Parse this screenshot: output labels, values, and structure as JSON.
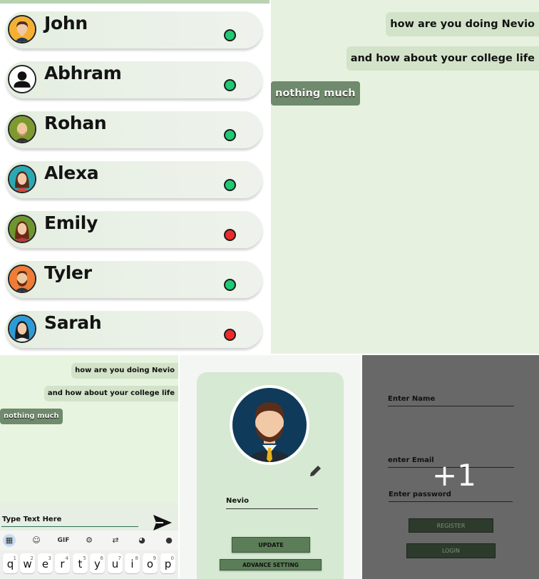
{
  "contacts": [
    {
      "name": "John",
      "status": "online",
      "status_color": "#1ecb74",
      "avatar": "man-orange-avatar-icon"
    },
    {
      "name": "Abhram",
      "status": "online",
      "status_color": "#1ecb74",
      "avatar": "default-person-icon"
    },
    {
      "name": "Rohan",
      "status": "online",
      "status_color": "#1ecb74",
      "avatar": "bald-man-avatar-icon"
    },
    {
      "name": "Alexa",
      "status": "online",
      "status_color": "#1ecb74",
      "avatar": "woman-teal-avatar-icon"
    },
    {
      "name": "Emily",
      "status": "offline",
      "status_color": "#ee2b2b",
      "avatar": "woman-green-avatar-icon"
    },
    {
      "name": "Tyler",
      "status": "online",
      "status_color": "#1ecb74",
      "avatar": "bearded-man-avatar-icon"
    },
    {
      "name": "Sarah",
      "status": "offline",
      "status_color": "#ee2b2b",
      "avatar": "woman-blue-avatar-icon"
    }
  ],
  "chat": {
    "messages": [
      {
        "text": "how are you doing Nevio",
        "direction": "sent"
      },
      {
        "text": "and how about your college life",
        "direction": "sent"
      },
      {
        "text": "nothing much",
        "direction": "received"
      }
    ],
    "input_placeholder": "Type Text Here"
  },
  "keyboard": {
    "toolbar": [
      "apps-icon",
      "sticker-icon",
      "GIF",
      "settings-icon",
      "translate-icon",
      "palette-icon",
      "mic-icon"
    ],
    "gif_label": "GIF",
    "keys": [
      {
        "k": "q",
        "n": "1"
      },
      {
        "k": "w",
        "n": "2"
      },
      {
        "k": "e",
        "n": "3"
      },
      {
        "k": "r",
        "n": "4"
      },
      {
        "k": "t",
        "n": "5"
      },
      {
        "k": "y",
        "n": "6"
      },
      {
        "k": "u",
        "n": "7"
      },
      {
        "k": "i",
        "n": "8"
      },
      {
        "k": "o",
        "n": "9"
      },
      {
        "k": "p",
        "n": "0"
      }
    ]
  },
  "profile": {
    "name_value": "Nevio",
    "update_label": "UPDATE",
    "advance_label": "ADVANCE SETTING"
  },
  "register": {
    "name_label": "Enter Name",
    "email_label": "enter Email",
    "password_label": "Enter password",
    "register_label": "REGISTER",
    "login_label": "LOGIN",
    "overlay_count": "+1"
  },
  "colors": {
    "online": "#1ecb74",
    "offline": "#ee2b2b",
    "chat_bg": "#e6f2df",
    "sent_bubble": "#d3e3c9",
    "received_bubble": "#6f8a6c"
  }
}
